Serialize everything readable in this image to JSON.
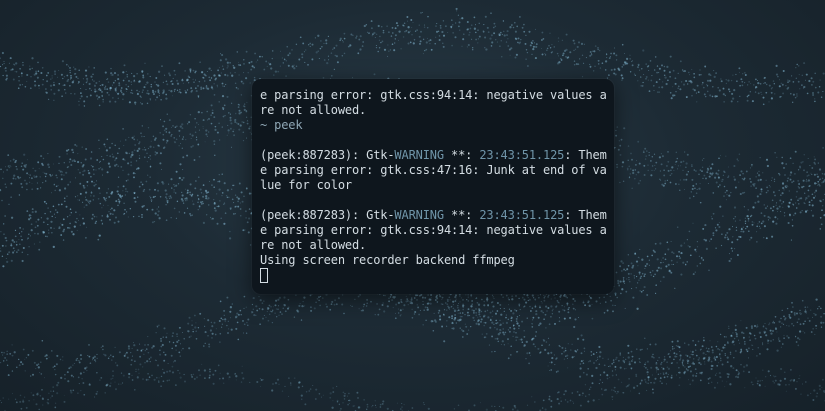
{
  "terminal": {
    "lines": [
      {
        "kind": "text",
        "text": "e parsing error: gtk.css:94:14: negative values a"
      },
      {
        "kind": "text",
        "text": "re not allowed."
      },
      {
        "kind": "prompt",
        "tilde": "~",
        "command": "peek"
      },
      {
        "kind": "blank"
      },
      {
        "kind": "warning",
        "prefix": "(peek:887283): Gtk-",
        "level": "WARNING",
        "stars": " **: ",
        "time": "23:43:51.125",
        "rest": ": Them"
      },
      {
        "kind": "text",
        "text": "e parsing error: gtk.css:47:16: Junk at end of va"
      },
      {
        "kind": "text",
        "text": "lue for color"
      },
      {
        "kind": "blank"
      },
      {
        "kind": "warning",
        "prefix": "(peek:887283): Gtk-",
        "level": "WARNING",
        "stars": " **: ",
        "time": "23:43:51.125",
        "rest": ": Them"
      },
      {
        "kind": "text",
        "text": "e parsing error: gtk.css:94:14: negative values a"
      },
      {
        "kind": "text",
        "text": "re not allowed."
      },
      {
        "kind": "text",
        "text": "Using screen recorder backend ffmpeg"
      },
      {
        "kind": "cursor"
      }
    ]
  },
  "colors": {
    "terminal_bg": "#0e161d",
    "text": "#d4dde3",
    "accent": "#6f94a8",
    "prompt": "#8fa7b5",
    "wallpaper_particles": "#8fc7e3"
  }
}
